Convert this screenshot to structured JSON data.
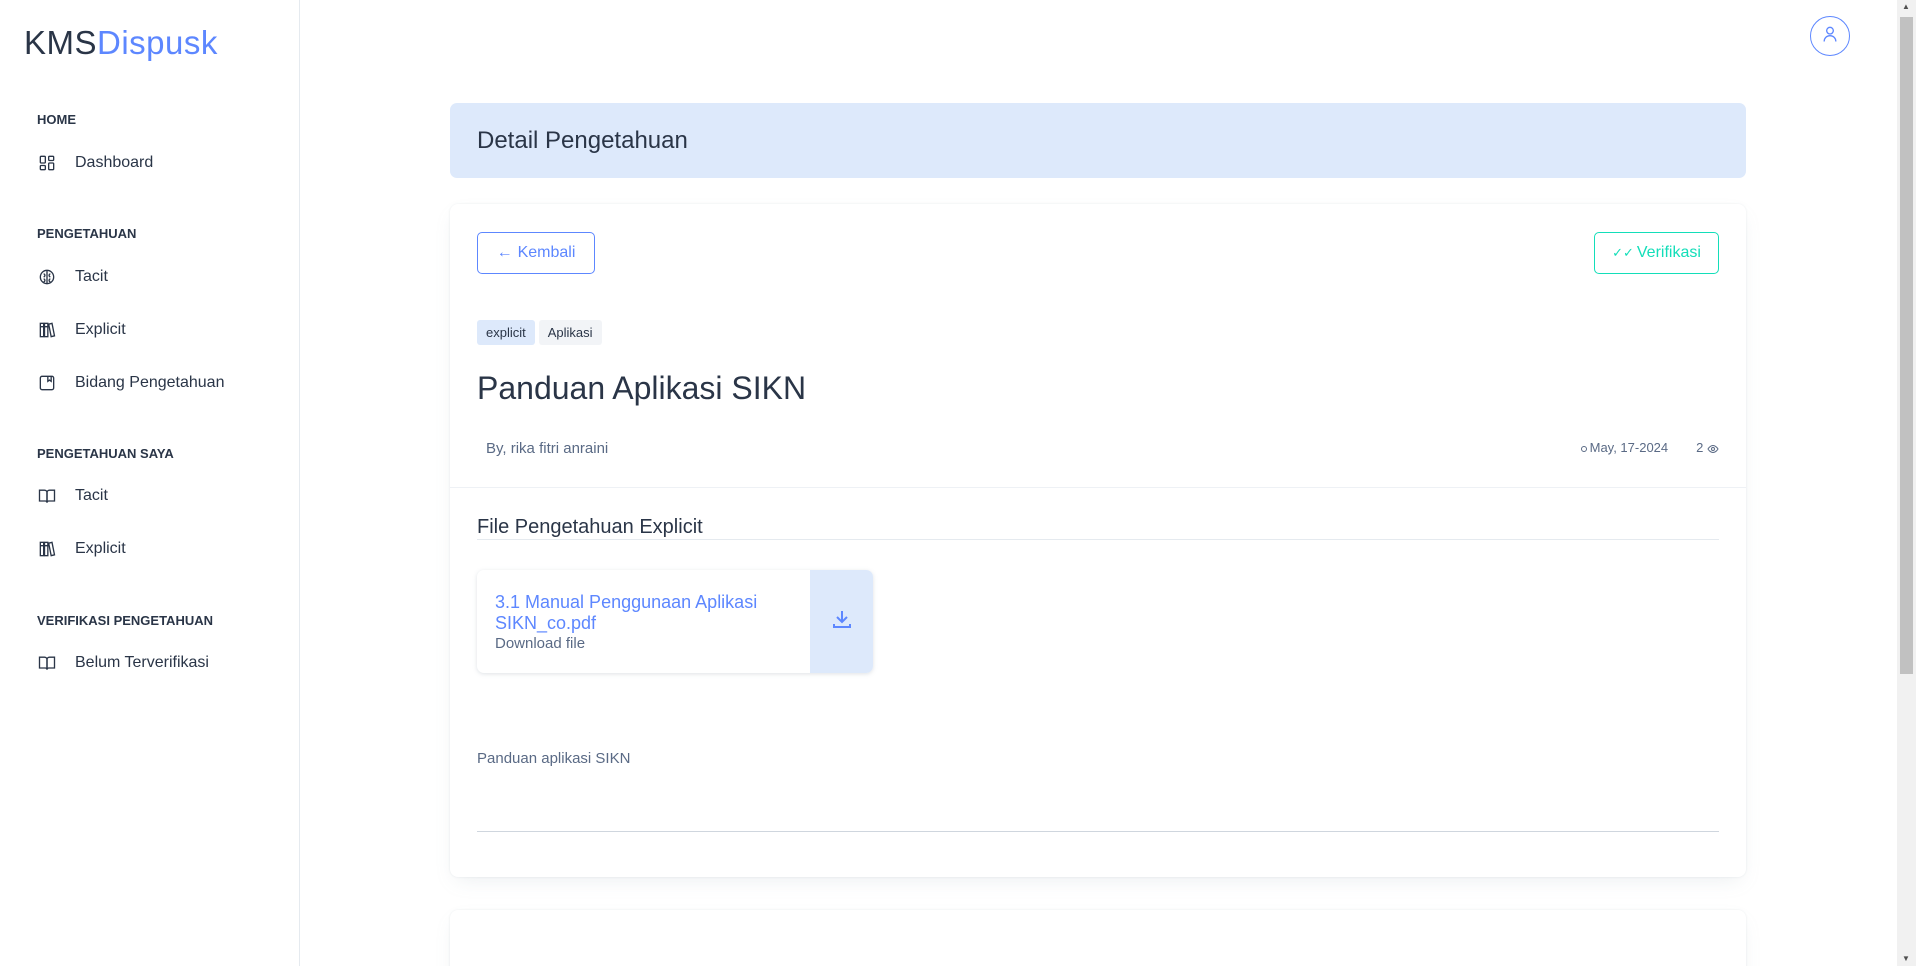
{
  "brand": {
    "part1": "KMS",
    "part2": "Dispusk"
  },
  "sidebar": {
    "sections": [
      {
        "title": "HOME",
        "items": [
          {
            "label": "Dashboard",
            "icon": "dashboard-icon"
          }
        ]
      },
      {
        "title": "PENGETAHUAN",
        "items": [
          {
            "label": "Tacit",
            "icon": "brain-icon"
          },
          {
            "label": "Explicit",
            "icon": "books-icon"
          },
          {
            "label": "Bidang Pengetahuan",
            "icon": "bookmark-icon"
          }
        ]
      },
      {
        "title": "PENGETAHUAN SAYA",
        "items": [
          {
            "label": "Tacit",
            "icon": "book-open-icon"
          },
          {
            "label": "Explicit",
            "icon": "books-icon"
          }
        ]
      },
      {
        "title": "VERIFIKASI PENGETAHUAN",
        "items": [
          {
            "label": "Belum Terverifikasi",
            "icon": "book-open-icon"
          }
        ]
      }
    ]
  },
  "header": {
    "title": "Detail Pengetahuan"
  },
  "detail": {
    "back_label": "Kembali",
    "verify_label": "Verifikasi",
    "tags": [
      "explicit",
      "Aplikasi"
    ],
    "title": "Panduan Aplikasi SIKN",
    "author": "By, rika fitri anraini",
    "date": "May, 17-2024",
    "views": "2",
    "file_section_title": "File Pengetahuan Explicit",
    "file": {
      "name": "3.1 Manual Penggunaan Aplikasi SIKN_co.pdf",
      "sub": "Download file"
    },
    "description": "Panduan aplikasi SIKN"
  },
  "colors": {
    "primary": "#5d87ff",
    "success": "#13deb9",
    "banner": "#dde9fb"
  }
}
